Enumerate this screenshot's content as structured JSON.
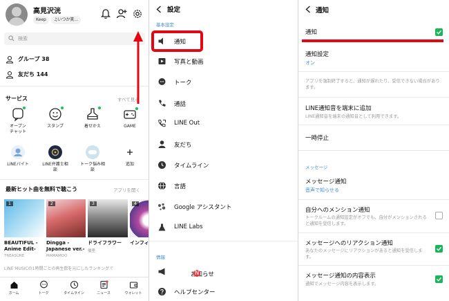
{
  "colors": {
    "line_green": "#19c05a",
    "link_blue": "#3f8ed6",
    "annotation_red": "#e30613"
  },
  "home": {
    "user_name": "高見沢洸",
    "chip_keep": "Keep",
    "chip_status": "♫いつか笑...",
    "search_placeholder": "検索",
    "groups": "グループ 38",
    "friends": "友だち 144",
    "services_title": "サービス",
    "services_more": "すべて見る",
    "services": [
      {
        "label": "オープン\nチャット",
        "icon": "open-chat-icon"
      },
      {
        "label": "スタンプ",
        "icon": "sticker-icon"
      },
      {
        "label": "着せかえ",
        "icon": "theme-icon"
      },
      {
        "label": "GAME",
        "icon": "game-icon"
      },
      {
        "label": "LINEバイト",
        "icon": "line-baito-icon"
      },
      {
        "label": "LINE弁護士相\n談",
        "icon": "lawyer-icon"
      },
      {
        "label": "トーク悩み相\n談",
        "icon": "consult-icon"
      },
      {
        "label": "追加",
        "icon": "add-icon"
      }
    ],
    "music_title": "最新ヒット曲を無料で聴こう",
    "music_more": "アプリを開く",
    "albums": [
      {
        "num": "1",
        "title": "BEAUTIFUL -\nAnime Edit-",
        "artist": "TREASURE"
      },
      {
        "num": "2",
        "title": "Dingga -\nJapanese ver.-",
        "artist": "MAMAMOO"
      },
      {
        "num": "3",
        "title": "ドライフラワー",
        "artist": "優里"
      },
      {
        "num": "4",
        "title": "インフィ",
        "artist": ""
      }
    ],
    "note": "LINE MUSICの1時間ごとの再生数を元にしたランキングで",
    "nav": [
      "ホーム",
      "トーク",
      "タイムライン",
      "ニュース",
      "ウォレット"
    ]
  },
  "settings": {
    "title": "設定",
    "section_basic": "基本設定",
    "items": [
      "通知",
      "写真と動画",
      "トーク",
      "通話",
      "LINE Out",
      "友だち",
      "タイムライン",
      "言語",
      "Google アシスタント",
      "LINE Labs"
    ],
    "section_info": "情報",
    "info_items": [
      "お知らせ",
      "ヘルプセンター"
    ],
    "news_badge": "N"
  },
  "notifications": {
    "title": "通知",
    "notify_label": "通知",
    "notify_on": true,
    "setting_label": "通知設定",
    "setting_value": "オン",
    "setting_desc": "アプリを強制終了すると、通知が遅れたり、受信できない場合があります。",
    "sound_label": "LINE通知音を端末に追加",
    "sound_desc": "LINE通知音を端末の通知音として利用できます。",
    "pause_label": "一時停止",
    "section_message": "メッセージ",
    "msg_notify_label": "メッセージ通知",
    "msg_notify_value": "音声で知らせる",
    "mention_label": "自分へのメンション通知",
    "mention_desc": "トークルームの通知設定がオフでも、自分がメンションされると通知を受信します。",
    "mention_on": false,
    "reaction_label": "メッセージへのリアクション通知",
    "reaction_desc": "あなたのメッセージにリアクションがあると通知を受信します。",
    "reaction_on": true,
    "preview_label": "メッセージ通知の内容表示",
    "preview_desc": "通知でメッセージ内容を表示します。",
    "preview_on": true
  }
}
